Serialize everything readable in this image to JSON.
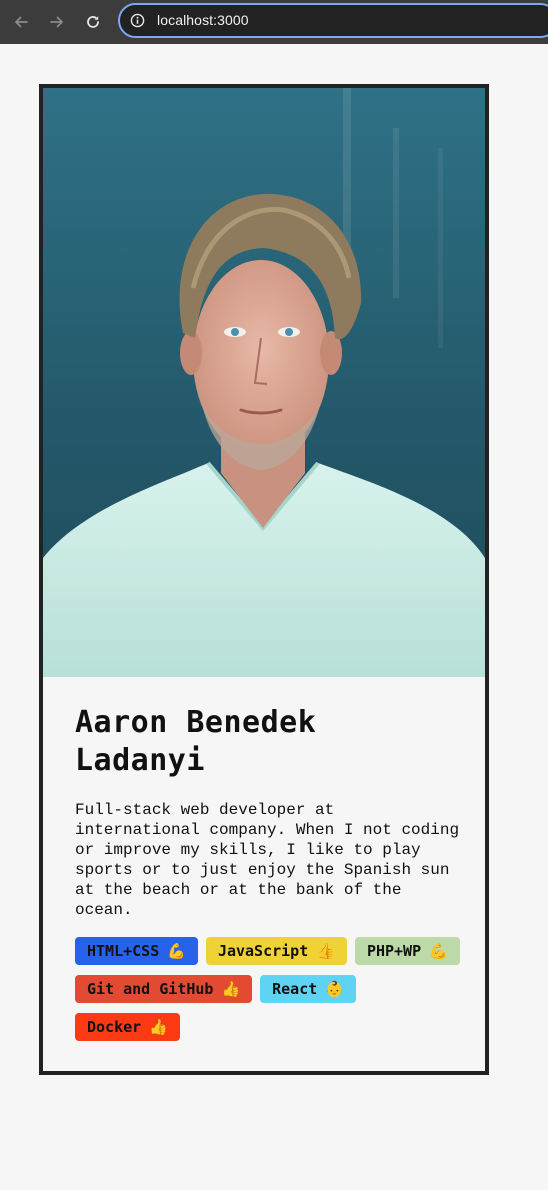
{
  "browser": {
    "url": "localhost:3000",
    "accent_color": "#7ca8ef"
  },
  "profile": {
    "name": "Aaron Benedek Ladanyi",
    "bio": "Full-stack web developer at international company. When I not coding or improve my skills, I like to play sports or to just enjoy the Spanish sun at the beach or at the bank of the ocean."
  },
  "skills": [
    {
      "label": "HTML+CSS",
      "emoji": "💪",
      "color": "#2662ea"
    },
    {
      "label": "JavaScript",
      "emoji": "👍",
      "color": "#efd236"
    },
    {
      "label": "PHP+WP",
      "emoji": "💪",
      "color": "#bdd9a8"
    },
    {
      "label": "Git and GitHub",
      "emoji": "👍",
      "color": "#e24b32"
    },
    {
      "label": "React",
      "emoji": "👶",
      "color": "#5fd3f3"
    },
    {
      "label": "Docker",
      "emoji": "👍",
      "color": "#fb3a14"
    }
  ]
}
